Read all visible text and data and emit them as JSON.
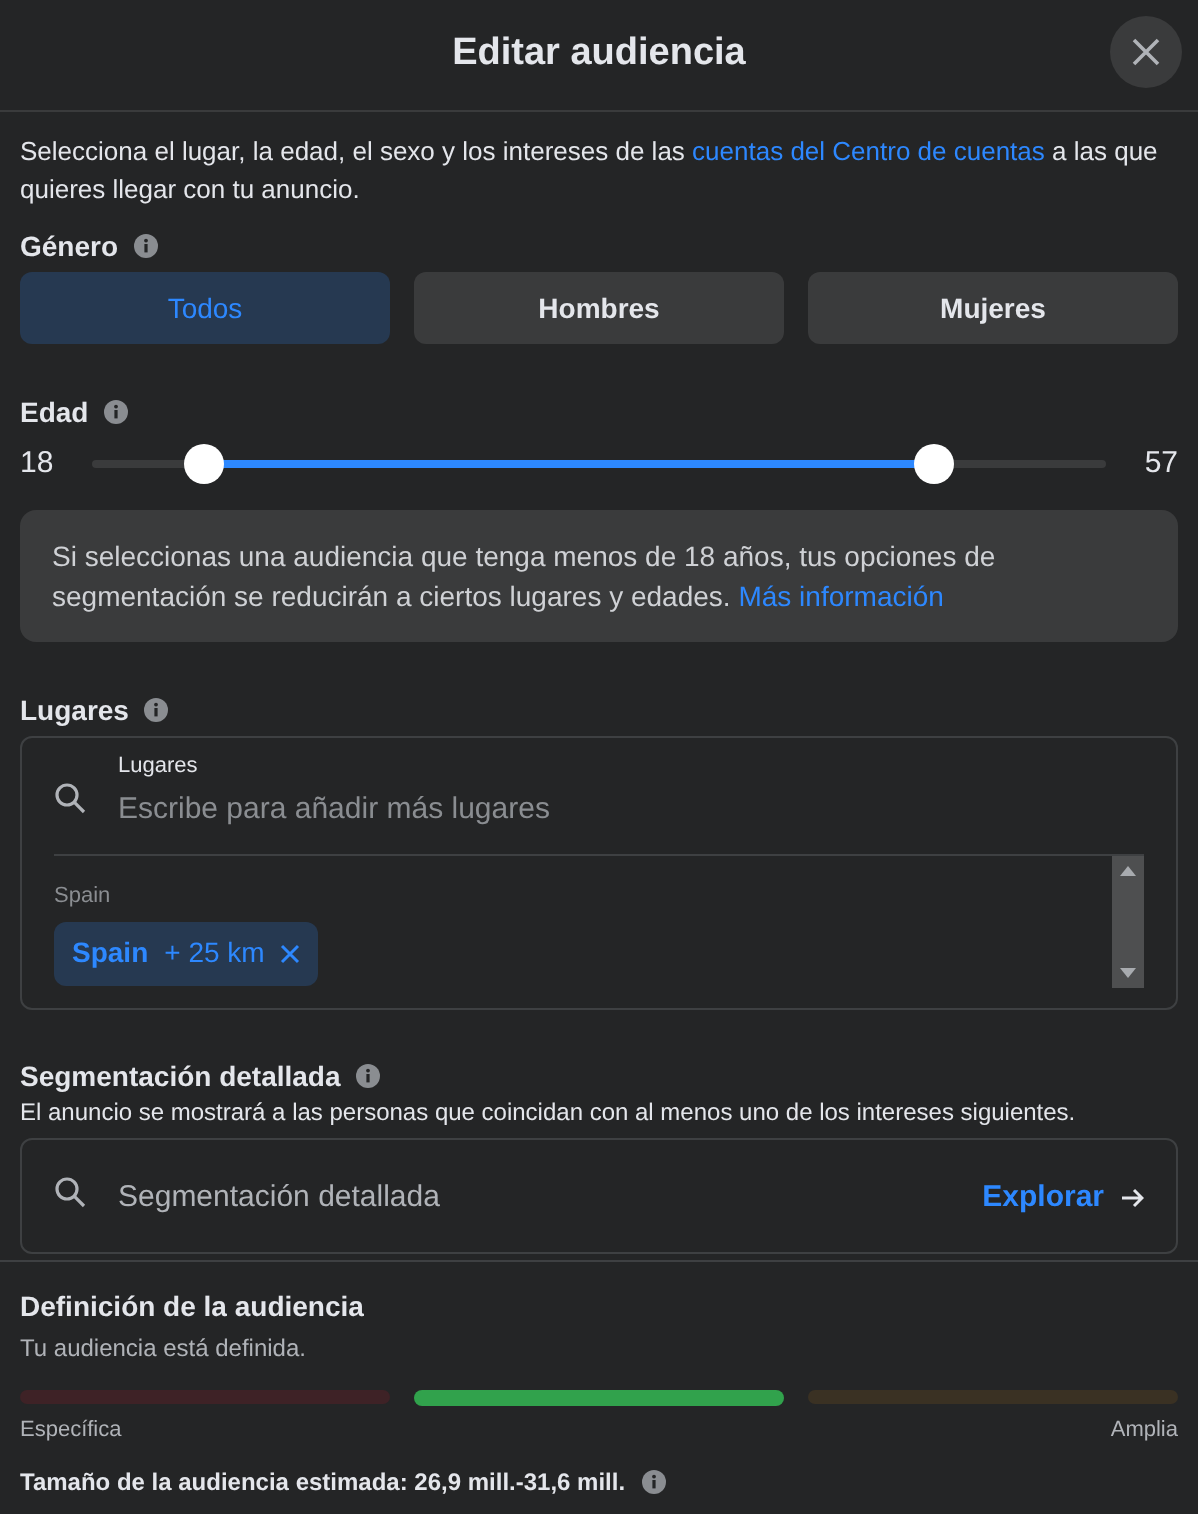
{
  "dialog": {
    "title": "Editar audiencia"
  },
  "intro": {
    "text": "Selecciona el lugar, la edad, el sexo y los intereses de las",
    "link": "cuentas del Centro de cuentas",
    "text_after": "a las que quieres llegar con tu anuncio."
  },
  "gender": {
    "label": "Género",
    "options": [
      {
        "label": "Todos",
        "selected": true
      },
      {
        "label": "Hombres",
        "selected": false
      },
      {
        "label": "Mujeres",
        "selected": false
      }
    ]
  },
  "age": {
    "label": "Edad",
    "min": "18",
    "max": "57",
    "thumbs": [
      {
        "level": 0.11
      },
      {
        "level": 0.83
      }
    ]
  },
  "notice": {
    "text": "Si seleccionas una audiencia que tenga menos de 18 años, tus opciones de segmentación se reducirán a ciertos lugares y edades.",
    "link": "Más información"
  },
  "locations": {
    "label": "Lugares",
    "field_label": "Lugares",
    "placeholder": "Escribe para añadir más lugares",
    "group": "Spain",
    "chips": [
      {
        "name": "Spain",
        "radius": "+ 25 km"
      }
    ]
  },
  "detailed_targeting": {
    "label": "Segmentación detallada",
    "description": "El anuncio se mostrará a las personas que coincidan con al menos uno de los intereses siguientes.",
    "placeholder": "Segmentación detallada",
    "action": "Explorar"
  },
  "audience_definition": {
    "title": "Definición de la audiencia",
    "status": "Tu audiencia está definida.",
    "segments": [
      {
        "color": "#3e2226",
        "selected": false
      },
      {
        "color": "#31a24c",
        "selected": true
      },
      {
        "color": "#3a3123",
        "selected": false
      }
    ],
    "left_label": "Específica",
    "right_label": "Amplia",
    "estimate": "Tamaño de la audiencia estimada: 26,9 mill.-31,6 mill."
  }
}
